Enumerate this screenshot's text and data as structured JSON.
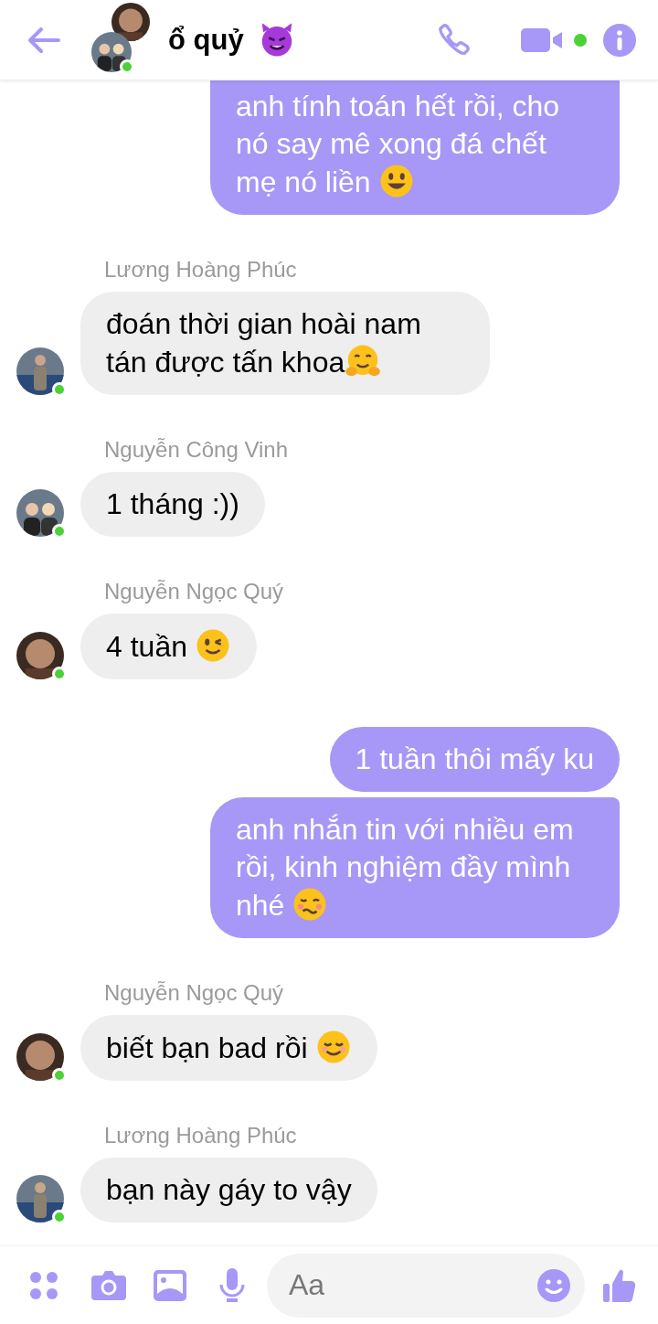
{
  "header": {
    "title": "ổ quỷ",
    "title_emoji": {
      "kind": "devil"
    },
    "online": true,
    "video_active": true
  },
  "messages": [
    {
      "mine": true,
      "text": "anh tính toán hết rồi, cho nó say mê xong đá chết mẹ nó liền",
      "emoji": {
        "kind": "grin"
      },
      "cut_top": true
    },
    {
      "mine": false,
      "sender": "Lương Hoàng Phúc",
      "text": "đoán thời gian hoài nam tán được tấn khoa",
      "emoji": {
        "kind": "hug"
      },
      "online": true
    },
    {
      "mine": false,
      "sender": "Nguyễn Công Vinh",
      "text": "1 tháng :))",
      "online": true
    },
    {
      "mine": false,
      "sender": "Nguyễn Ngọc Quý",
      "text": "4 tuần",
      "emoji": {
        "kind": "wink"
      },
      "online": true
    },
    {
      "mine": true,
      "text": "1 tuần thôi mấy ku"
    },
    {
      "mine": true,
      "text": "anh nhắn tin với nhiều em rồi, kinh nghiệm đầy mình nhé",
      "emoji": {
        "kind": "woozy"
      },
      "grouped": true
    },
    {
      "mine": false,
      "sender": "Nguyễn Ngọc Quý",
      "text": "biết bạn bad rồi",
      "emoji": {
        "kind": "blush"
      },
      "online": true
    },
    {
      "mine": false,
      "sender": "Lương Hoàng Phúc",
      "text": "bạn này gáy to vậy",
      "online": true
    }
  ],
  "composer": {
    "placeholder": "Aa"
  }
}
